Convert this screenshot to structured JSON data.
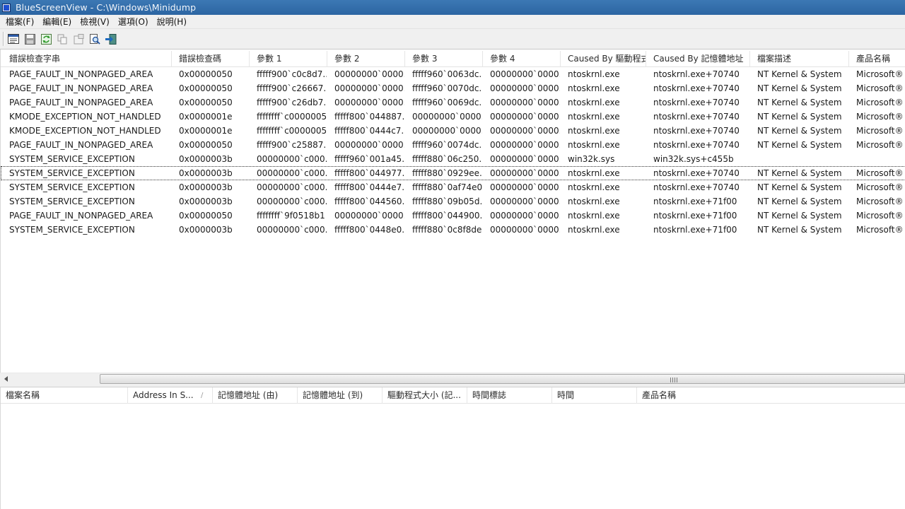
{
  "titlebar": {
    "title": "BlueScreenView  -  C:\\Windows\\Minidump"
  },
  "menu": [
    "檔案(F)",
    "編輯(E)",
    "檢視(V)",
    "選項(O)",
    "說明(H)"
  ],
  "toolbar": {
    "icons": [
      "html-report-icon",
      "save-icon",
      "refresh-icon",
      "copy-icon",
      "properties-icon",
      "find-icon",
      "exit-icon"
    ]
  },
  "upper_list": {
    "columns": [
      "錯誤檢查字串",
      "錯誤檢查碼",
      "參數 1",
      "參數 2",
      "參數 3",
      "參數 4",
      "Caused By 驅動程式",
      "Caused By 記憶體地址",
      "檔案描述",
      "產品名稱"
    ],
    "rows": [
      [
        "PAGE_FAULT_IN_NONPAGED_AREA",
        "0x00000050",
        "fffff900`c0c8d7...",
        "00000000`0000...",
        "fffff960`0063dc...",
        "00000000`0000...",
        "ntoskrnl.exe",
        "ntoskrnl.exe+70740",
        "NT Kernel & System",
        "Microsoft® W"
      ],
      [
        "PAGE_FAULT_IN_NONPAGED_AREA",
        "0x00000050",
        "fffff900`c26667...",
        "00000000`0000...",
        "fffff960`0070dc...",
        "00000000`0000...",
        "ntoskrnl.exe",
        "ntoskrnl.exe+70740",
        "NT Kernel & System",
        "Microsoft® W"
      ],
      [
        "PAGE_FAULT_IN_NONPAGED_AREA",
        "0x00000050",
        "fffff900`c26db7...",
        "00000000`0000...",
        "fffff960`0069dc...",
        "00000000`0000...",
        "ntoskrnl.exe",
        "ntoskrnl.exe+70740",
        "NT Kernel & System",
        "Microsoft® W"
      ],
      [
        "KMODE_EXCEPTION_NOT_HANDLED",
        "0x0000001e",
        "ffffffff`c0000005",
        "fffff800`044887...",
        "00000000`0000...",
        "00000000`0000...",
        "ntoskrnl.exe",
        "ntoskrnl.exe+70740",
        "NT Kernel & System",
        "Microsoft® W"
      ],
      [
        "KMODE_EXCEPTION_NOT_HANDLED",
        "0x0000001e",
        "ffffffff`c0000005",
        "fffff800`0444c7...",
        "00000000`0000...",
        "00000000`0000...",
        "ntoskrnl.exe",
        "ntoskrnl.exe+70740",
        "NT Kernel & System",
        "Microsoft® W"
      ],
      [
        "PAGE_FAULT_IN_NONPAGED_AREA",
        "0x00000050",
        "fffff900`c25887...",
        "00000000`0000...",
        "fffff960`0074dc...",
        "00000000`0000...",
        "ntoskrnl.exe",
        "ntoskrnl.exe+70740",
        "NT Kernel & System",
        "Microsoft® W"
      ],
      [
        "SYSTEM_SERVICE_EXCEPTION",
        "0x0000003b",
        "00000000`c000...",
        "fffff960`001a45...",
        "fffff880`06c250...",
        "00000000`0000...",
        "win32k.sys",
        "win32k.sys+c455b",
        "",
        ""
      ],
      [
        "SYSTEM_SERVICE_EXCEPTION",
        "0x0000003b",
        "00000000`c000...",
        "fffff800`044977...",
        "fffff880`0929ee...",
        "00000000`0000...",
        "ntoskrnl.exe",
        "ntoskrnl.exe+70740",
        "NT Kernel & System",
        "Microsoft® W"
      ],
      [
        "SYSTEM_SERVICE_EXCEPTION",
        "0x0000003b",
        "00000000`c000...",
        "fffff800`0444e7...",
        "fffff880`0af74e00",
        "00000000`0000...",
        "ntoskrnl.exe",
        "ntoskrnl.exe+70740",
        "NT Kernel & System",
        "Microsoft® W"
      ],
      [
        "SYSTEM_SERVICE_EXCEPTION",
        "0x0000003b",
        "00000000`c000...",
        "fffff800`044560...",
        "fffff880`09b05d...",
        "00000000`0000...",
        "ntoskrnl.exe",
        "ntoskrnl.exe+71f00",
        "NT Kernel & System",
        "Microsoft® W"
      ],
      [
        "PAGE_FAULT_IN_NONPAGED_AREA",
        "0x00000050",
        "ffffffff`9f0518b1",
        "00000000`0000...",
        "fffff800`044900...",
        "00000000`0000...",
        "ntoskrnl.exe",
        "ntoskrnl.exe+71f00",
        "NT Kernel & System",
        "Microsoft® W"
      ],
      [
        "SYSTEM_SERVICE_EXCEPTION",
        "0x0000003b",
        "00000000`c000...",
        "fffff800`0448e0...",
        "fffff880`0c8f8de0",
        "00000000`0000...",
        "ntoskrnl.exe",
        "ntoskrnl.exe+71f00",
        "NT Kernel & System",
        "Microsoft® W"
      ]
    ],
    "focused_row": 7
  },
  "lower_list": {
    "columns": [
      "檔案名稱",
      "Address In S...",
      "記憶體地址 (由)",
      "記憶體地址 (到)",
      "驅動程式大小 (記...",
      "時間標誌",
      "時間",
      "產品名稱"
    ],
    "sort_indicator": "/",
    "rows": []
  }
}
